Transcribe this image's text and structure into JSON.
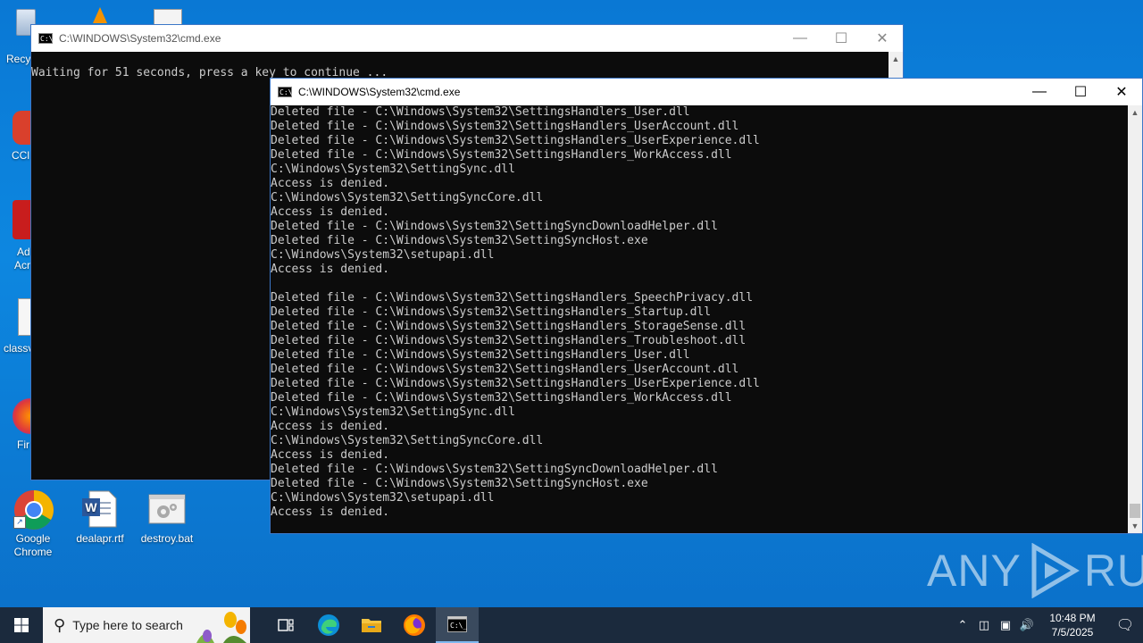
{
  "desktop": {
    "icons": [
      {
        "label": "Google Chrome",
        "name": "google-chrome"
      },
      {
        "label": "dealapr.rtf",
        "name": "dealapr-rtf"
      },
      {
        "label": "destroy.bat",
        "name": "destroy-bat"
      }
    ],
    "edge_labels": [
      "Recy",
      "CCl",
      "Ad",
      "Acr",
      "classv",
      "Fir"
    ]
  },
  "back_window": {
    "title": "C:\\WINDOWS\\System32\\cmd.exe",
    "lines": [
      "Waiting for 51 seconds, press a key to continue ..."
    ]
  },
  "front_window": {
    "title": "C:\\WINDOWS\\System32\\cmd.exe",
    "lines": [
      "Deleted file - C:\\Windows\\System32\\SettingsHandlers_User.dll",
      "Deleted file - C:\\Windows\\System32\\SettingsHandlers_UserAccount.dll",
      "Deleted file - C:\\Windows\\System32\\SettingsHandlers_UserExperience.dll",
      "Deleted file - C:\\Windows\\System32\\SettingsHandlers_WorkAccess.dll",
      "C:\\Windows\\System32\\SettingSync.dll",
      "Access is denied.",
      "C:\\Windows\\System32\\SettingSyncCore.dll",
      "Access is denied.",
      "Deleted file - C:\\Windows\\System32\\SettingSyncDownloadHelper.dll",
      "Deleted file - C:\\Windows\\System32\\SettingSyncHost.exe",
      "C:\\Windows\\System32\\setupapi.dll",
      "Access is denied.",
      "",
      "Deleted file - C:\\Windows\\System32\\SettingsHandlers_SpeechPrivacy.dll",
      "Deleted file - C:\\Windows\\System32\\SettingsHandlers_Startup.dll",
      "Deleted file - C:\\Windows\\System32\\SettingsHandlers_StorageSense.dll",
      "Deleted file - C:\\Windows\\System32\\SettingsHandlers_Troubleshoot.dll",
      "Deleted file - C:\\Windows\\System32\\SettingsHandlers_User.dll",
      "Deleted file - C:\\Windows\\System32\\SettingsHandlers_UserAccount.dll",
      "Deleted file - C:\\Windows\\System32\\SettingsHandlers_UserExperience.dll",
      "Deleted file - C:\\Windows\\System32\\SettingsHandlers_WorkAccess.dll",
      "C:\\Windows\\System32\\SettingSync.dll",
      "Access is denied.",
      "C:\\Windows\\System32\\SettingSyncCore.dll",
      "Access is denied.",
      "Deleted file - C:\\Windows\\System32\\SettingSyncDownloadHelper.dll",
      "Deleted file - C:\\Windows\\System32\\SettingSyncHost.exe",
      "C:\\Windows\\System32\\setupapi.dll",
      "Access is denied."
    ]
  },
  "taskbar": {
    "search_placeholder": "Type here to search",
    "time": "10:48 PM",
    "date": "7/5/2025"
  },
  "watermark": {
    "left": "ANY",
    "right": "RUN"
  },
  "colors": {
    "desktop": "#0a78d4",
    "console_bg": "#0c0c0c",
    "console_text": "#cccccc",
    "taskbar": "#1b2a3d"
  }
}
